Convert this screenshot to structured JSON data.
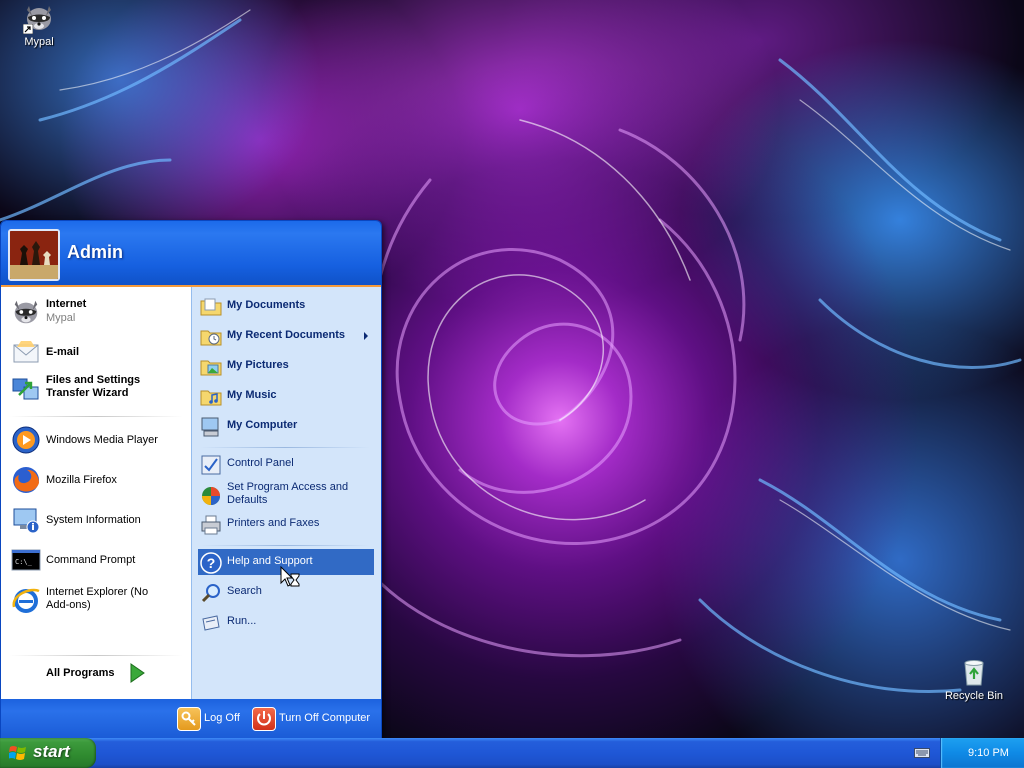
{
  "desktop": {
    "icons": [
      {
        "label": "Mypal",
        "icon": "raccoon-icon"
      },
      {
        "label": "Recycle Bin",
        "icon": "recycle-bin-icon"
      }
    ]
  },
  "start_menu": {
    "user": {
      "name": "Admin"
    },
    "pinned": [
      {
        "title": "Internet",
        "subtitle": "Mypal",
        "icon": "raccoon-icon"
      },
      {
        "title": "E-mail",
        "icon": "email-icon"
      },
      {
        "title_line1": "Files and Settings",
        "title_line2": "Transfer Wizard",
        "icon": "transfer-wizard-icon"
      }
    ],
    "recent": [
      {
        "label": "Windows Media Player",
        "icon": "media-player-icon"
      },
      {
        "label": "Mozilla Firefox",
        "icon": "firefox-icon"
      },
      {
        "label": "System Information",
        "icon": "system-info-icon"
      },
      {
        "label": "Command Prompt",
        "icon": "command-prompt-icon"
      },
      {
        "label_line1": "Internet Explorer (No",
        "label_line2": "Add-ons)",
        "icon": "internet-explorer-icon"
      }
    ],
    "all_programs": "All Programs",
    "places": [
      {
        "label": "My Documents",
        "icon": "folder-icon"
      },
      {
        "label": "My Recent Documents",
        "icon": "recent-docs-icon",
        "has_submenu": true
      },
      {
        "label": "My Pictures",
        "icon": "pictures-folder-icon"
      },
      {
        "label": "My Music",
        "icon": "music-folder-icon"
      },
      {
        "label": "My Computer",
        "icon": "computer-icon"
      }
    ],
    "system": [
      {
        "label": "Control Panel",
        "icon": "control-panel-icon"
      },
      {
        "label_line1": "Set Program Access and",
        "label_line2": "Defaults",
        "icon": "program-access-icon"
      },
      {
        "label": "Printers and Faxes",
        "icon": "printer-icon"
      }
    ],
    "tools": [
      {
        "label": "Help and Support",
        "icon": "help-icon",
        "highlighted": true
      },
      {
        "label": "Search",
        "icon": "search-icon"
      },
      {
        "label": "Run...",
        "icon": "run-icon"
      }
    ],
    "footer": {
      "log_off": "Log Off",
      "turn_off": "Turn Off Computer"
    }
  },
  "taskbar": {
    "start_label": "start",
    "clock": "9:10 PM"
  },
  "colors": {
    "taskbar_blue": "#245edb",
    "start_green": "#3c9a3c",
    "highlight": "#316ac5",
    "places_pane": "#d3e5fa",
    "header_accent": "#f59a3a"
  }
}
